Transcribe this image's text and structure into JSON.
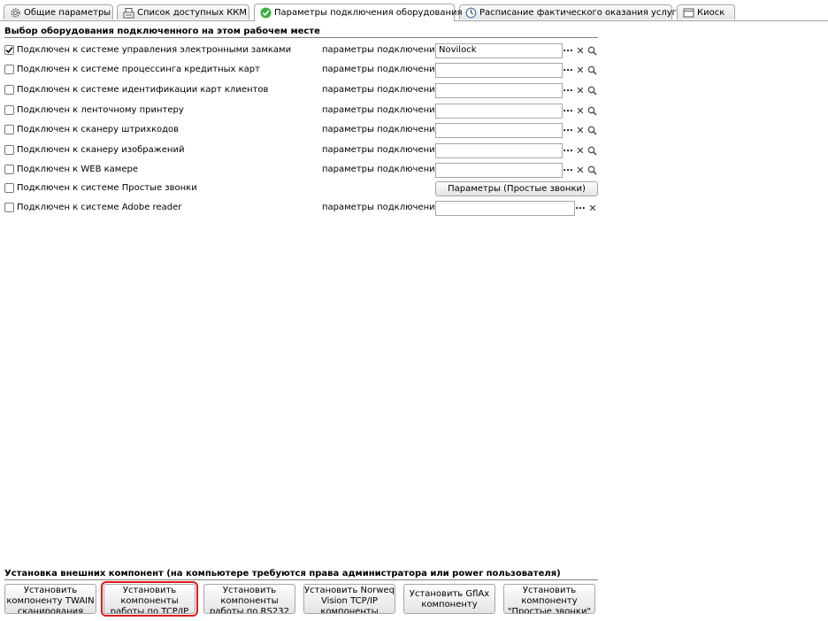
{
  "tabs": [
    {
      "label": "Общие параметры",
      "icon": "gear-icon"
    },
    {
      "label": "Список доступных ККМ",
      "icon": "register-icon"
    },
    {
      "label": "Параметры подключения оборудования",
      "icon": "check-circle-icon",
      "active": true
    },
    {
      "label": "Расписание фактического оказания услуг",
      "icon": "clock-icon"
    },
    {
      "label": "Киоск",
      "icon": "window-icon"
    }
  ],
  "section_equipment": {
    "title": "Выбор оборудования подключенного на этом рабочем месте"
  },
  "param_label": "параметры подключения:",
  "devices": [
    {
      "label": "Подключен к системе управления электронными замками",
      "checked": true,
      "value": "Novilock"
    },
    {
      "label": "Подключен к системе процессинга кредитных карт",
      "checked": false,
      "value": ""
    },
    {
      "label": "Подключен к системе идентификации карт клиентов",
      "checked": false,
      "value": ""
    },
    {
      "label": "Подключен к ленточному принтеру",
      "checked": false,
      "value": ""
    },
    {
      "label": "Подключен к сканеру штрихкодов",
      "checked": false,
      "value": ""
    },
    {
      "label": "Подключен к сканеру изображений",
      "checked": false,
      "value": ""
    },
    {
      "label": "Подключен к WEB камере",
      "checked": false,
      "value": ""
    }
  ],
  "simple_calls": {
    "label": "Подключен к системе Простые звонки",
    "checked": false,
    "button": "Параметры (Простые звонки)"
  },
  "adobe": {
    "label": "Подключен к системе Adobe reader",
    "checked": false,
    "value": ""
  },
  "section_components": {
    "title": "Установка внешних компонент (на компьютере требуются права администратора или power пользователя)"
  },
  "components": [
    {
      "label": "Установить компоненту TWAIN сканирования"
    },
    {
      "label": "Установить компоненты работы по TCP/IP",
      "highlighted": true
    },
    {
      "label": "Установить компоненты работы по RS232"
    },
    {
      "label": "Установить Norweq Vision TCP/IP компоненты"
    },
    {
      "label": "Установить GflAx компоненту"
    },
    {
      "label": "Установить компоненту \"Простые звонки\""
    }
  ],
  "colors": {
    "highlight": "#e0191c",
    "active_tab_icon": "#3cb043"
  }
}
